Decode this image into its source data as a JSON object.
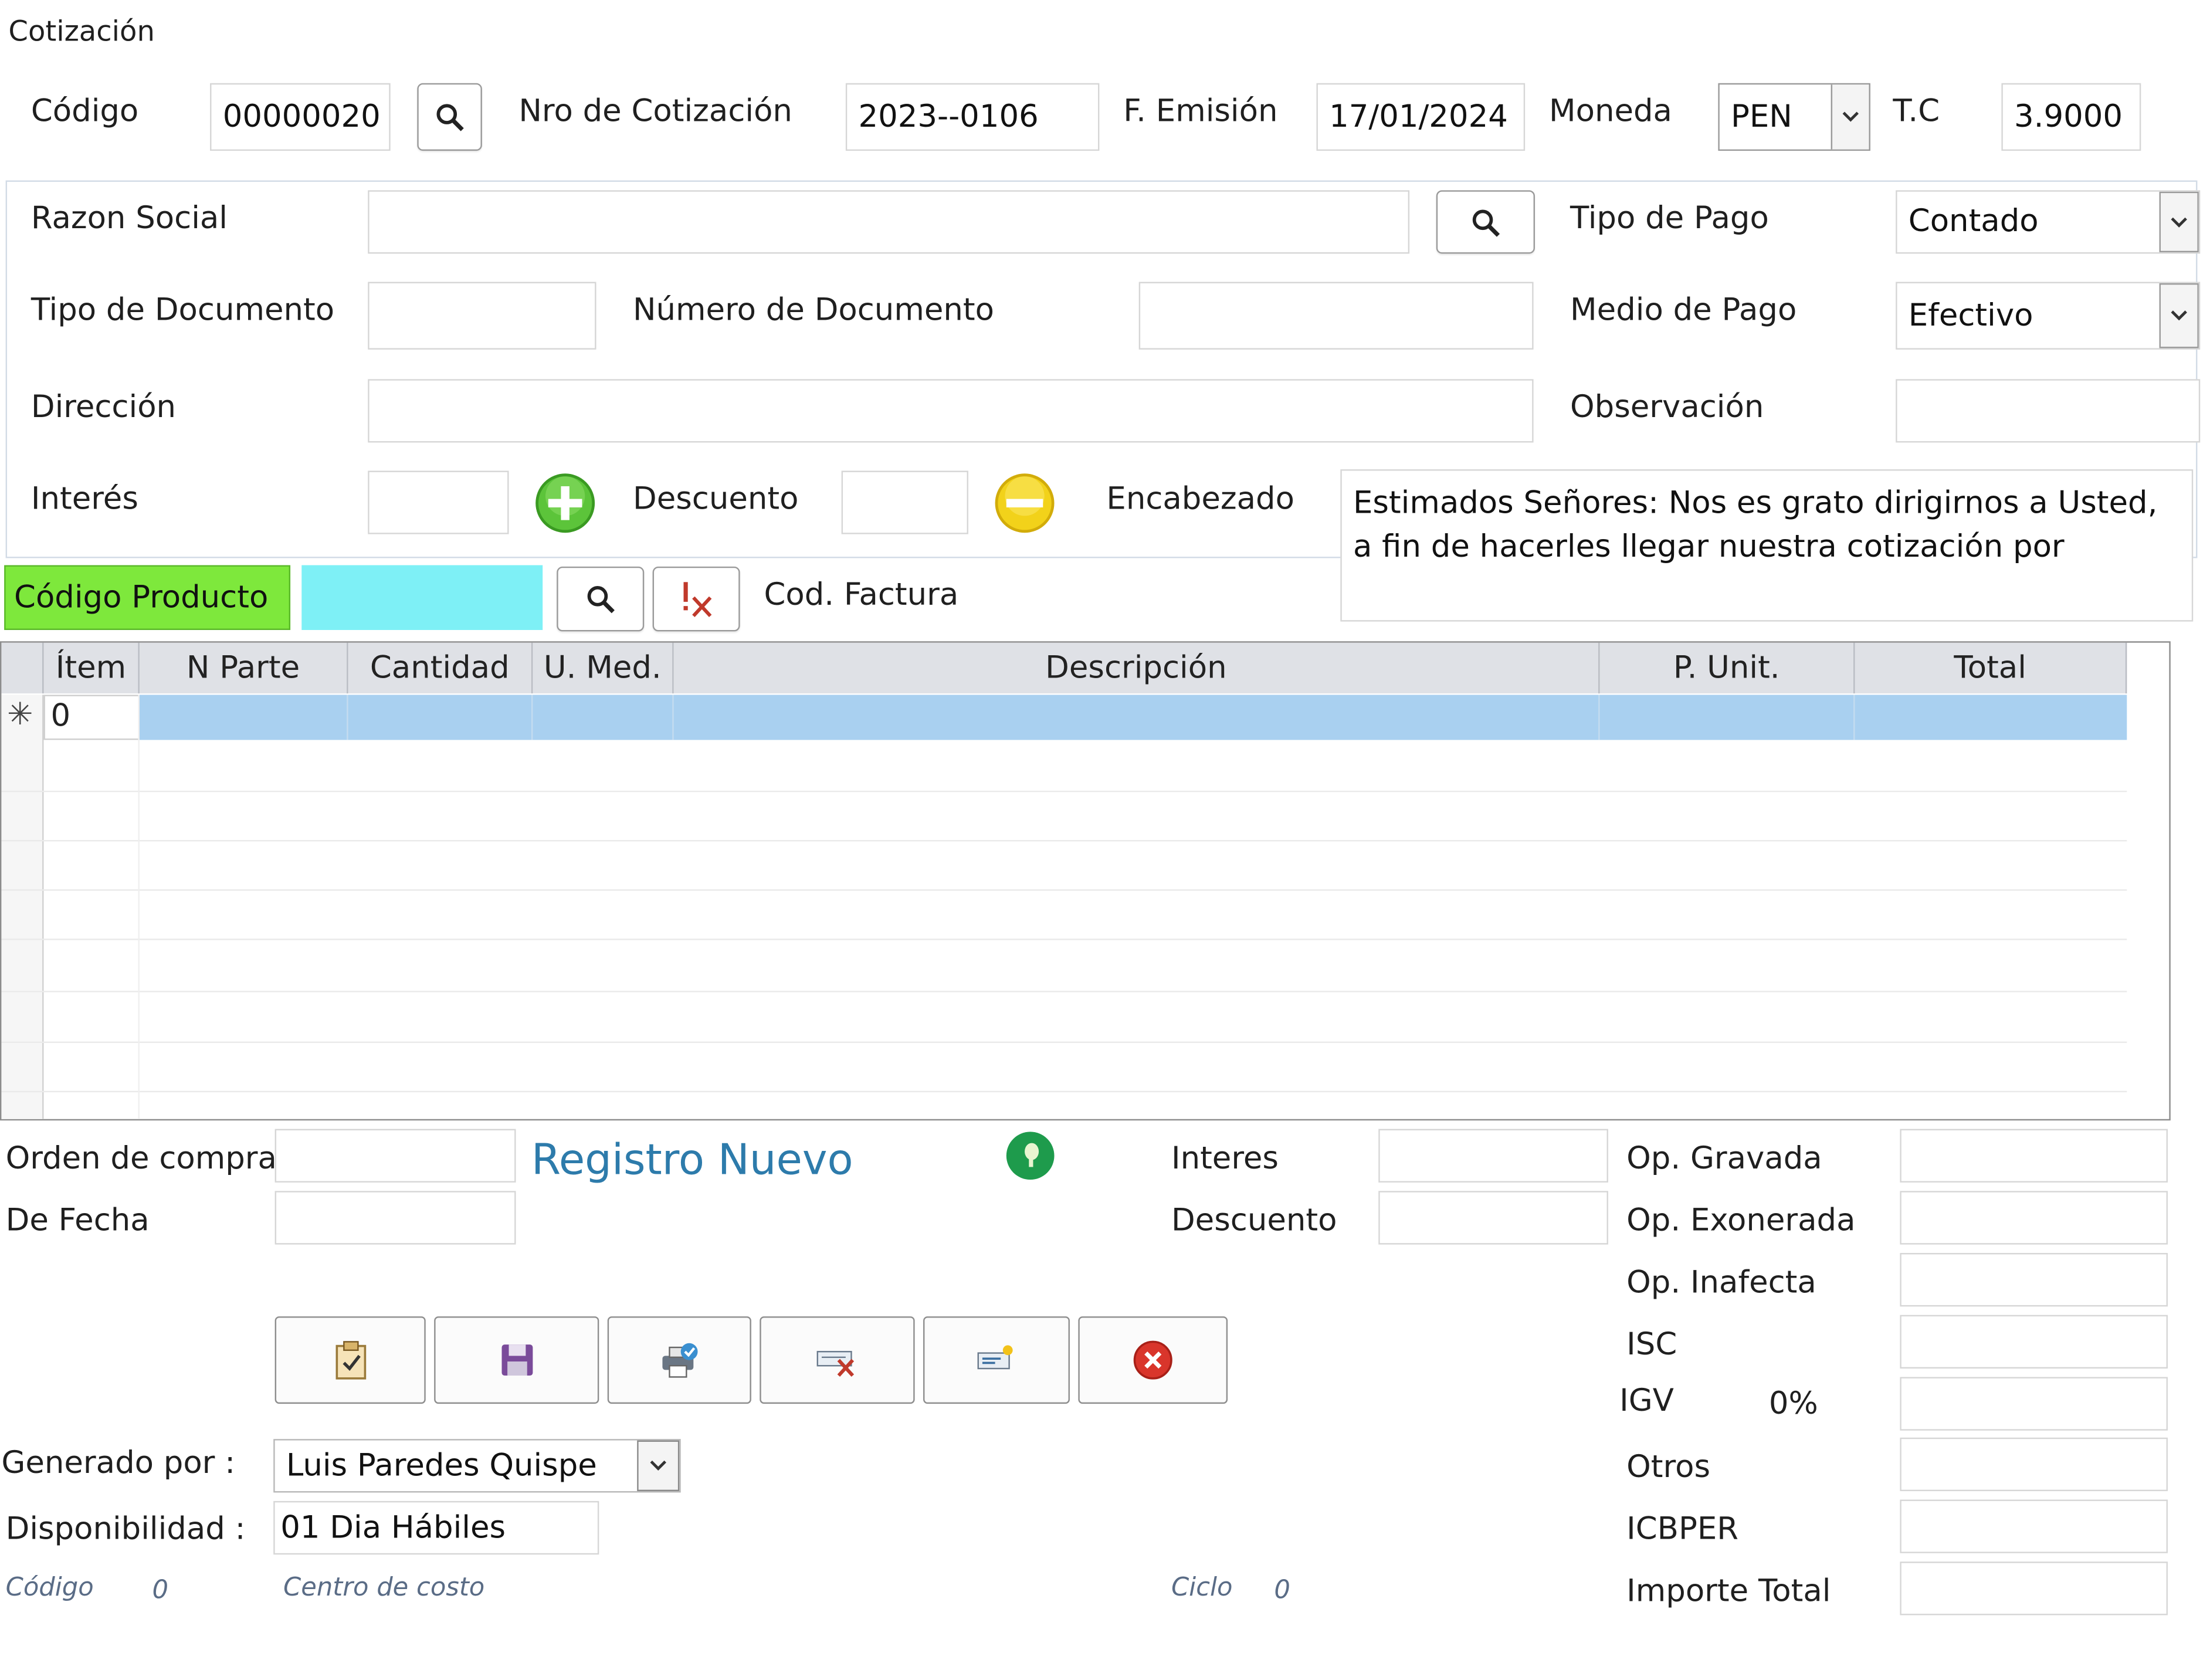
{
  "window": {
    "title": "Cotización"
  },
  "header": {
    "codigo_label": "Código",
    "codigo_value": "00000020",
    "nro_label": "Nro de Cotización",
    "nro_value": "2023--0106",
    "emision_label": "F. Emisión",
    "emision_value": "17/01/2024",
    "moneda_label": "Moneda",
    "moneda_value": "PEN",
    "tc_label": "T.C",
    "tc_value": "3.9000"
  },
  "client": {
    "razon_label": "Razon Social",
    "razon_value": "",
    "tipo_pago_label": "Tipo de Pago",
    "tipo_pago_value": "Contado",
    "tipo_doc_label": "Tipo de Documento",
    "tipo_doc_value": "",
    "num_doc_label": "Número de Documento",
    "num_doc_value": "",
    "medio_pago_label": "Medio de Pago",
    "medio_pago_value": "Efectivo",
    "direccion_label": "Dirección",
    "direccion_value": "",
    "observacion_label": "Observación",
    "observacion_value": "",
    "interes_label": "Interés",
    "descuento_label": "Descuento",
    "encabezado_label": "Encabezado",
    "encabezado_value": "Estimados Señores: Nos es grato dirigirnos a Usted, a fin de hacerles llegar nuestra cotización por"
  },
  "product_bar": {
    "codigo_producto_label": "Código Producto",
    "cod_factura_label": "Cod. Factura"
  },
  "grid": {
    "columns": [
      "Ítem",
      "N Parte",
      "Cantidad",
      "U. Med.",
      "Descripción",
      "P. Unit.",
      "Total"
    ],
    "new_row_marker": "✳",
    "rows": [
      {
        "item": "0",
        "n_parte": "",
        "cantidad": "",
        "u_med": "",
        "descripcion": "",
        "p_unit": "",
        "total": ""
      }
    ]
  },
  "footer": {
    "orden_compra_label": "Orden de compra",
    "de_fecha_label": "De Fecha",
    "registro_nuevo": "Registro Nuevo",
    "interes_label": "Interes",
    "descuento_label": "Descuento",
    "generado_label": "Generado por :",
    "generado_value": "Luis Paredes Quispe",
    "disponibilidad_label": "Disponibilidad :",
    "disponibilidad_value": "01 Dia Hábiles",
    "codigo_small_label": "Código",
    "codigo_small_value": "0",
    "centro_costo_label": "Centro de costo",
    "ciclo_label": "Ciclo",
    "ciclo_value": "0"
  },
  "totals": {
    "op_gravada": "Op. Gravada",
    "op_exonerada": "Op. Exonerada",
    "op_inafecta": "Op. Inafecta",
    "isc": "ISC",
    "igv": "IGV",
    "igv_pct": "0%",
    "otros": "Otros",
    "icbper": "ICBPER",
    "importe_total": "Importe Total"
  },
  "colors": {
    "codigo_producto_bg": "#7ee83c",
    "codigo_input_bg": "#7ef0f6",
    "grid_selected_row": "#a9d0f0",
    "registro_nuevo": "#2d7bab"
  }
}
